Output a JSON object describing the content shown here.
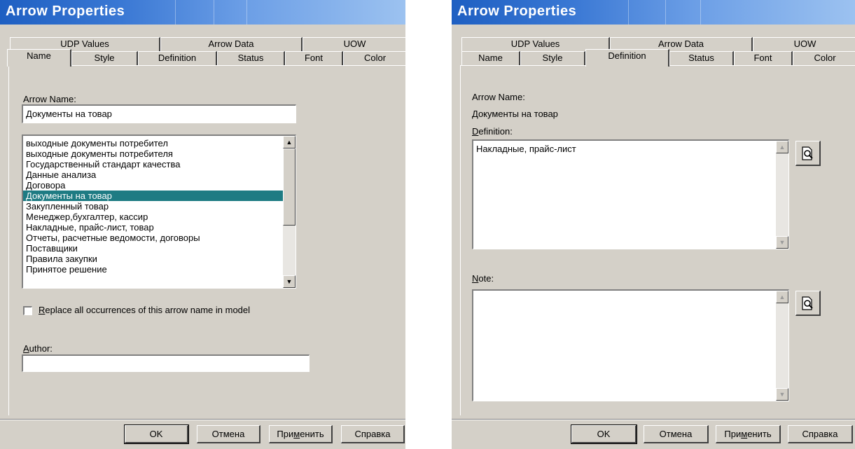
{
  "left": {
    "title": "Arrow Properties",
    "tabs_back": [
      "UDP Values",
      "Arrow Data",
      "UOW"
    ],
    "tabs_front": [
      "Name",
      "Style",
      "Definition",
      "Status",
      "Font",
      "Color"
    ],
    "arrow_name_label": "Arrow Name:",
    "arrow_name_value": "Документы на товар",
    "list_items": [
      "выходные документы  потребител",
      "выходные документы  потребителя",
      "Государственный стандарт качества",
      "Данные анализа",
      "Договора",
      "Документы на товар",
      "Закупленный товар",
      "Менеджер,бухгалтер, кассир",
      "Накладные, прайс-лист, товар",
      "Отчеты, расчетные ведомости, договоры",
      "Поставщики",
      "Правила закупки",
      "Принятое решение"
    ],
    "selected_index": 5,
    "replace_label_prefix": "R",
    "replace_label_rest": "eplace all occurrences of this arrow name in model",
    "author_label_prefix": "A",
    "author_label_rest": "uthor:",
    "author_value": "",
    "buttons": {
      "ok": "OK",
      "cancel": "Отмена",
      "apply_prefix": "При",
      "apply_underline": "м",
      "apply_rest": "енить",
      "help": "Справка"
    }
  },
  "right": {
    "title": "Arrow Properties",
    "tabs_back": [
      "UDP Values",
      "Arrow Data",
      "UOW"
    ],
    "tabs_front": [
      "Name",
      "Style",
      "Definition",
      "Status",
      "Font",
      "Color"
    ],
    "arrow_name_label": "Arrow Name:",
    "arrow_name_value": "Документы на товар",
    "definition_label_prefix": "D",
    "definition_label_rest": "efinition:",
    "definition_value": "Накладные, прайс-лист",
    "note_label_prefix": "N",
    "note_label_rest": "ote:",
    "note_value": "",
    "buttons": {
      "ok": "OK",
      "cancel": "Отмена",
      "apply_prefix": "При",
      "apply_underline": "м",
      "apply_rest": "енить",
      "help": "Справка"
    }
  },
  "colors": {
    "dialog_bg": "#d4d0c8",
    "selection": "#1e7b83",
    "title_gradient_start": "#1e5fc2"
  }
}
